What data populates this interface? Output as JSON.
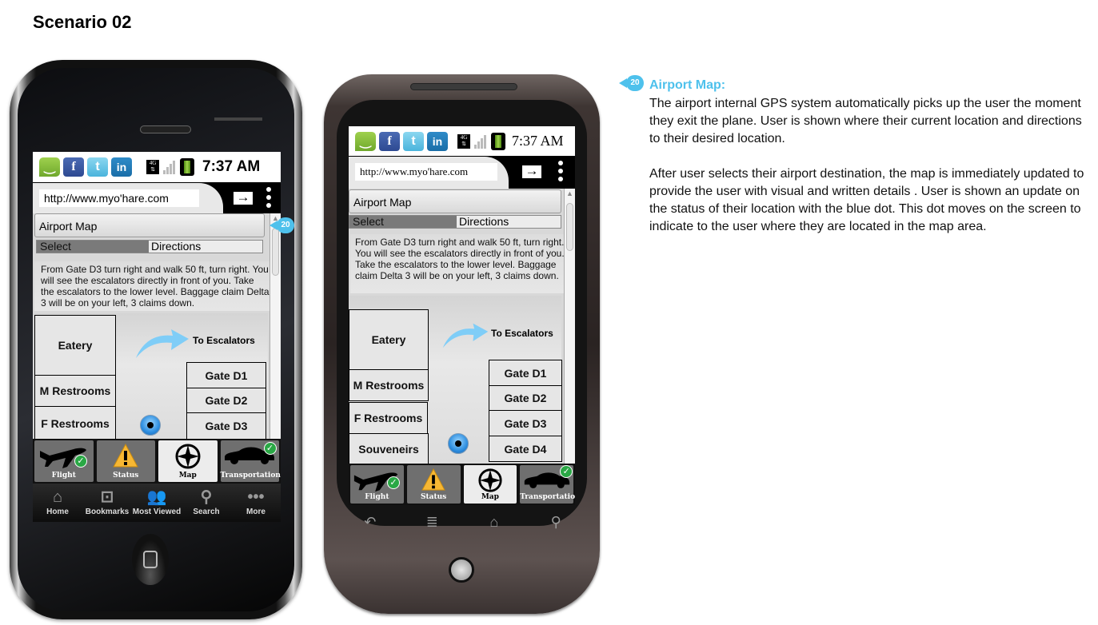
{
  "page": {
    "title": "Scenario 02"
  },
  "phone_screen": {
    "url": "http://www.myo'hare.com",
    "time": "7:37 AM",
    "network": "4G",
    "status_icons": [
      "message-icon",
      "facebook-icon",
      "twitter-icon",
      "linkedin-icon"
    ],
    "panel_title": "Airport Map",
    "segment": {
      "select_label": "Select",
      "directions_label": "Directions"
    },
    "directions_text": "From Gate D3 turn right and walk 50 ft, turn right. You will see the escalators directly in front of you. Take the escalators to the lower level. Baggage claim Delta 3 will be on your left, 3 claims down.",
    "map": {
      "escalator_label": "To Escalators",
      "left_rooms": [
        "Eatery",
        "M Restrooms",
        "F Restrooms",
        "Souveneirs"
      ],
      "gates": [
        "Gate D1",
        "Gate D2",
        "Gate D3",
        "Gate D4"
      ]
    },
    "app_nav": [
      {
        "label": "Flight",
        "checked": true
      },
      {
        "label": "Status",
        "checked": false
      },
      {
        "label": "Map",
        "checked": false,
        "active": true
      },
      {
        "label": "Transportation",
        "checked": true
      }
    ],
    "ios_toolbar": [
      "Home",
      "Bookmarks",
      "Most Viewed",
      "Search",
      "More"
    ],
    "android_buttons": [
      "back-icon",
      "menu-icon",
      "home-icon",
      "search-icon"
    ]
  },
  "annotation": {
    "badge_number": "20",
    "title": "Airport Map:",
    "paragraphs": [
      "The airport internal GPS system automatically picks up the user the moment they exit the plane. User is shown where their current location and directions to their desired location.",
      "After user selects their airport destination, the map is immediately updated to provide the user with visual and written details . User is shown an update on the status of their location with the blue dot. This dot moves on the screen to indicate to the user where they are located in the map area."
    ],
    "accent_color": "#4ec1ec"
  }
}
